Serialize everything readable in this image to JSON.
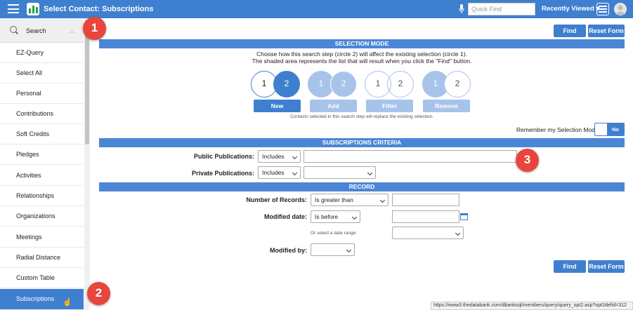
{
  "header": {
    "title": "Select Contact: Subscriptions",
    "quick_find_placeholder": "Quick Find",
    "recently_viewed": "Recently Viewed ▾",
    "bg": "#3f7fcf"
  },
  "sidebar": {
    "search_label": "Search",
    "items": [
      "EZ-Query",
      "Select All",
      "Personal",
      "Contributions",
      "Soft Credits",
      "Pledges",
      "Activities",
      "Relationships",
      "Organizations",
      "Meetings",
      "Radial Distance",
      "Custom Table",
      "Subscriptions"
    ],
    "active": "Subscriptions"
  },
  "buttons": {
    "find": "Find",
    "reset": "Reset Form"
  },
  "selection_mode": {
    "title": "SELECTION MODE",
    "line1": "Choose how this search step (circle 2) will affect the existing selection (circle 1).",
    "line2": "The shaded area represents the list that will result when you click the \"Find\" button.",
    "modes": [
      "New",
      "Add",
      "Filter",
      "Remove"
    ],
    "circle1": "1",
    "circle2": "2",
    "note": "Contacts selected in this search step will replace the existing selection.",
    "remember_label": "Remember my Selection Mode",
    "toggle_value": "No"
  },
  "subscriptions_criteria": {
    "title": "SUBSCRIPTIONS CRITERIA",
    "public_label": "Public Publications:",
    "public_op": "Includes",
    "private_label": "Private Publications:",
    "private_op": "Includes"
  },
  "record": {
    "title": "RECORD",
    "num_records_label": "Number of Records:",
    "num_records_op": "Is greater than",
    "modified_date_label": "Modified date:",
    "modified_date_op": "Is before",
    "date_range_label": "Or select a date range:",
    "modified_by_label": "Modified by:"
  },
  "annotations": [
    "1",
    "2",
    "3"
  ],
  "status_url": "https://www3.thedatabank.com/dbanksql/members/query/query_opt2.asp?opt2defid=312"
}
